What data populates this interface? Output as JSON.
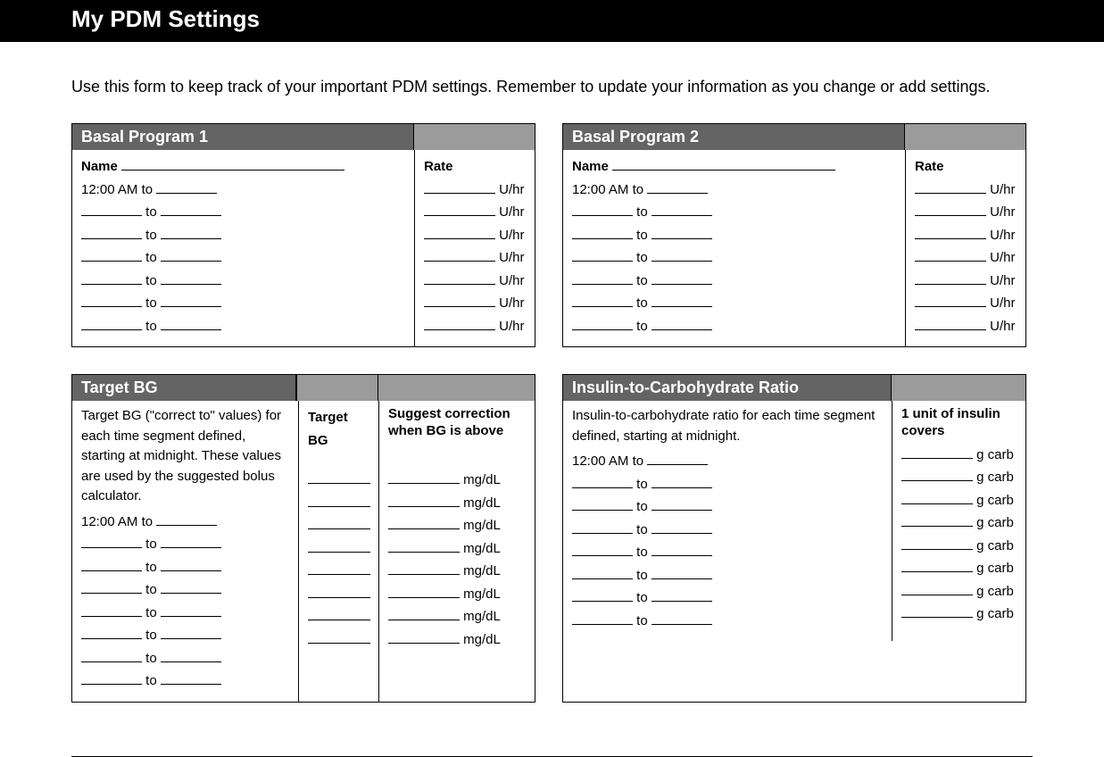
{
  "header": {
    "title": "My PDM Settings"
  },
  "intro": "Use this form to keep track of your important PDM settings. Remember to update your information as you change or add settings.",
  "basal1": {
    "title": "Basal Program 1",
    "name_label": "Name",
    "first_start": "12:00 AM",
    "to": "to",
    "rate_label": "Rate",
    "rate_unit": "U/hr"
  },
  "basal2": {
    "title": "Basal Program 2",
    "name_label": "Name",
    "first_start": "12:00 AM",
    "to": "to",
    "rate_label": "Rate",
    "rate_unit": "U/hr"
  },
  "target_bg": {
    "title": "Target BG",
    "desc": "Target BG (\"correct to\" values) for each time segment defined, starting at midnight. These values are used by the suggested bolus calculator.",
    "first_start": "12:00 AM",
    "to": "to",
    "col2": "Target BG",
    "col3": "Suggest correction when BG is above",
    "unit": "mg/dL"
  },
  "ic_ratio": {
    "title": "Insulin-to-Carbohydrate Ratio",
    "desc": "Insulin-to-carbohydrate ratio for each time segment defined, starting at midnight.",
    "first_start": "12:00 AM",
    "to": "to",
    "col2": "1 unit of insulin covers",
    "unit": "g carb"
  }
}
